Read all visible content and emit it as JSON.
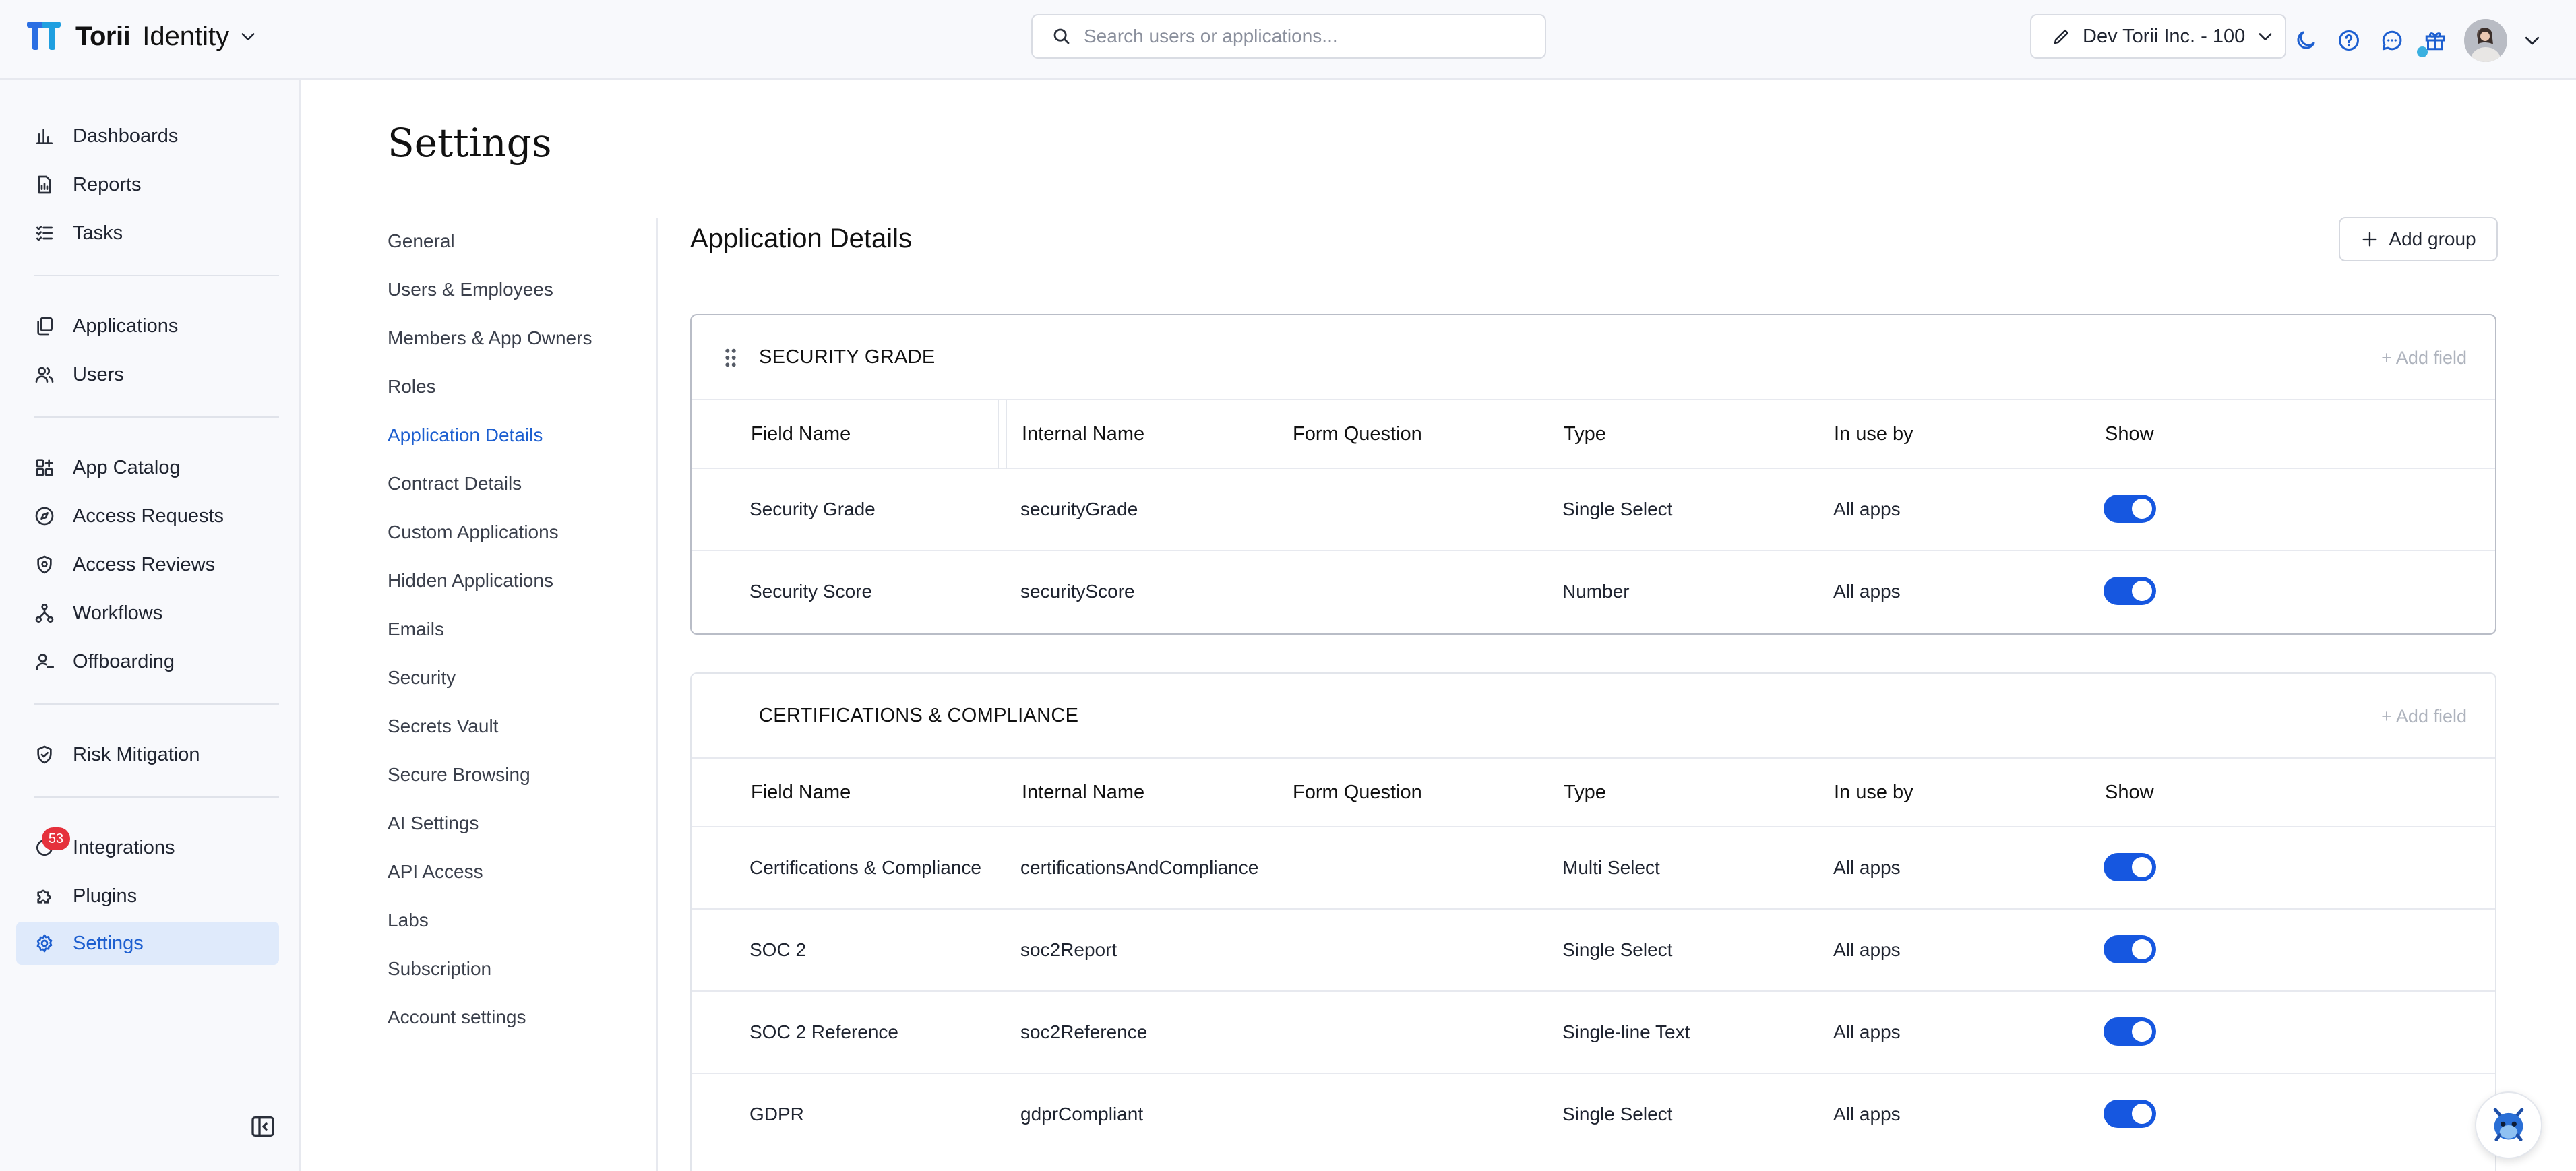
{
  "app": {
    "brand": "Torii",
    "product": "Identity"
  },
  "search": {
    "placeholder": "Search users or applications..."
  },
  "org_selector": {
    "label": "Dev Torii Inc. - 100"
  },
  "nav": {
    "dashboards": "Dashboards",
    "reports": "Reports",
    "tasks": "Tasks",
    "applications": "Applications",
    "users": "Users",
    "app_catalog": "App Catalog",
    "access_requests": "Access Requests",
    "access_reviews": "Access Reviews",
    "workflows": "Workflows",
    "offboarding": "Offboarding",
    "risk_mitigation": "Risk Mitigation",
    "integrations": "Integrations",
    "integrations_badge": "53",
    "plugins": "Plugins",
    "settings": "Settings"
  },
  "page": {
    "title": "Settings"
  },
  "settings_menu": [
    "General",
    "Users & Employees",
    "Members & App Owners",
    "Roles",
    "Application Details",
    "Contract Details",
    "Custom Applications",
    "Hidden Applications",
    "Emails",
    "Security",
    "Secrets Vault",
    "Secure Browsing",
    "AI Settings",
    "API Access",
    "Labs",
    "Subscription",
    "Account settings"
  ],
  "active_menu_item": "Application Details",
  "section": {
    "title": "Application Details",
    "add_group_label": "Add group"
  },
  "columns": [
    "Field Name",
    "Internal Name",
    "Form Question",
    "Type",
    "In use by",
    "Show"
  ],
  "groups": [
    {
      "name": "SECURITY GRADE",
      "add_field_label": "+ Add field",
      "rows": [
        {
          "field_name": "Security Grade",
          "internal_name": "securityGrade",
          "form_question": "",
          "type": "Single Select",
          "in_use_by": "All apps",
          "show": true
        },
        {
          "field_name": "Security Score",
          "internal_name": "securityScore",
          "form_question": "",
          "type": "Number",
          "in_use_by": "All apps",
          "show": true
        }
      ]
    },
    {
      "name": "CERTIFICATIONS & COMPLIANCE",
      "add_field_label": "+ Add field",
      "rows": [
        {
          "field_name": "Certifications & Compliance",
          "internal_name": "certificationsAndCompliance",
          "form_question": "",
          "type": "Multi Select",
          "in_use_by": "All apps",
          "show": true
        },
        {
          "field_name": "SOC 2",
          "internal_name": "soc2Report",
          "form_question": "",
          "type": "Single Select",
          "in_use_by": "All apps",
          "show": true
        },
        {
          "field_name": "SOC 2 Reference",
          "internal_name": "soc2Reference",
          "form_question": "",
          "type": "Single-line Text",
          "in_use_by": "All apps",
          "show": true
        },
        {
          "field_name": "GDPR",
          "internal_name": "gdprCompliant",
          "form_question": "",
          "type": "Single Select",
          "in_use_by": "All apps",
          "show": true
        }
      ]
    }
  ],
  "colors": {
    "accent": "#1657e0",
    "active_nav_bg": "#dfeafb",
    "badge": "#e5313c"
  }
}
